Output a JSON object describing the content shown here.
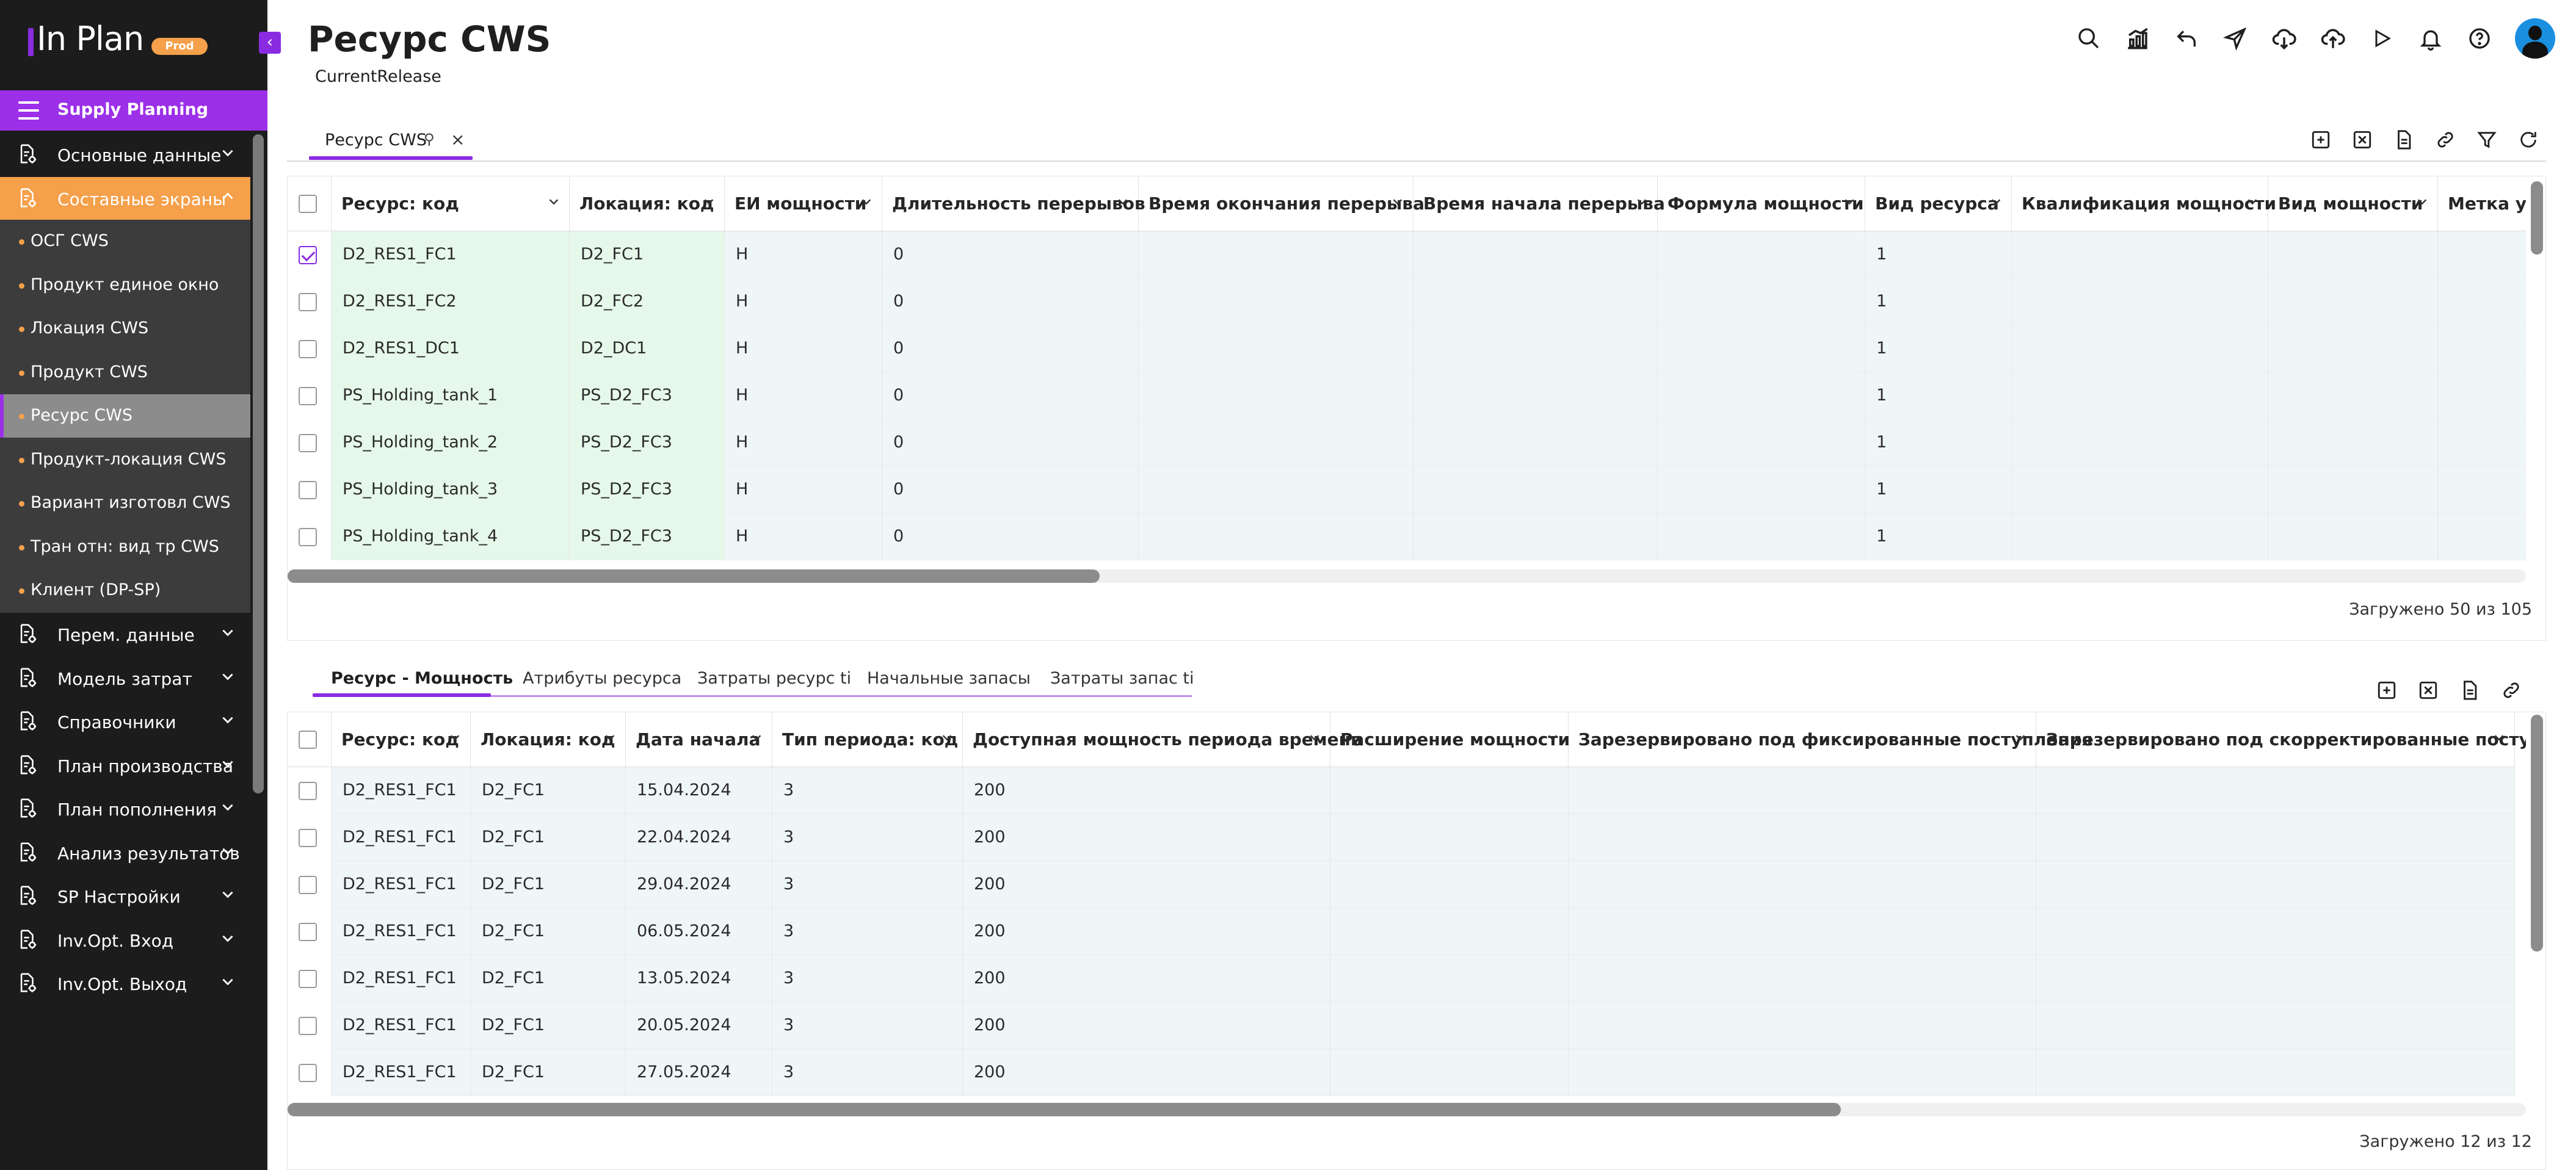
{
  "app": {
    "logo_text": "In Plan",
    "env_badge": "Prod",
    "colors": {
      "accent": "#8a2be2",
      "nav_active": "#f5a04a",
      "sidebar_bg": "#1c1c1c",
      "key_column_bg": "#e6f8e9",
      "row_tint": "#eff6f8"
    }
  },
  "sidebar": {
    "section_title": "Supply Planning",
    "top_items": [
      {
        "label": "Основные данные",
        "icon": "document-gear-icon"
      },
      {
        "label": "Составные экраны",
        "icon": "document-gear-icon"
      }
    ],
    "sub_items": [
      {
        "label": "ОСГ CWS"
      },
      {
        "label": "Продукт единое окно"
      },
      {
        "label": "Локация CWS"
      },
      {
        "label": "Продукт CWS"
      },
      {
        "label": "Ресурс CWS"
      },
      {
        "label": "Продукт-локация CWS"
      },
      {
        "label": "Вариант изготовл CWS"
      },
      {
        "label": "Тран отн: вид тр CWS"
      },
      {
        "label": "Клиент (DP-SP)"
      }
    ],
    "bottom_items": [
      {
        "label": "Перем. данные",
        "icon": "document-gear-icon"
      },
      {
        "label": "Модель затрат",
        "icon": "document-gear-icon"
      },
      {
        "label": "Справочники",
        "icon": "document-gear-icon"
      },
      {
        "label": "План производства",
        "icon": "document-gear-icon"
      },
      {
        "label": "План пополнения",
        "icon": "document-gear-icon"
      },
      {
        "label": "Анализ результатов",
        "icon": "document-gear-icon"
      },
      {
        "label": "SP Настройки",
        "icon": "document-gear-icon"
      },
      {
        "label": "Inv.Opt. Вход",
        "icon": "document-gear-icon"
      },
      {
        "label": "Inv.Opt. Выход",
        "icon": "document-gear-icon"
      }
    ]
  },
  "header": {
    "title": "Ресурс CWS",
    "subtitle": "CurrentRelease",
    "icons": [
      "search-icon",
      "chart-icon",
      "undo-icon",
      "send-icon",
      "cloud-download-icon",
      "cloud-upload-icon",
      "play-icon",
      "bell-icon",
      "help-icon"
    ]
  },
  "tabs": [
    {
      "label": "Ресурс CWS"
    }
  ],
  "grid_main": {
    "columns": [
      {
        "label": "Ресурс: код"
      },
      {
        "label": "Локация: код"
      },
      {
        "label": "ЕИ мощности"
      },
      {
        "label": "Длительность перерывов"
      },
      {
        "label": "Время окончания перерыва"
      },
      {
        "label": "Время начала перерыва"
      },
      {
        "label": "Формула мощности"
      },
      {
        "label": "Вид ресурса"
      },
      {
        "label": "Квалификация мощности"
      },
      {
        "label": "Вид мощности"
      },
      {
        "label": "Метка уда"
      }
    ],
    "rows": [
      {
        "checked": true,
        "cells": [
          "D2_RES1_FC1",
          "D2_FC1",
          "H",
          "0",
          "",
          "",
          "",
          "1",
          "",
          "",
          ""
        ]
      },
      {
        "checked": false,
        "cells": [
          "D2_RES1_FC2",
          "D2_FC2",
          "H",
          "0",
          "",
          "",
          "",
          "1",
          "",
          "",
          ""
        ]
      },
      {
        "checked": false,
        "cells": [
          "D2_RES1_DC1",
          "D2_DC1",
          "H",
          "0",
          "",
          "",
          "",
          "1",
          "",
          "",
          ""
        ]
      },
      {
        "checked": false,
        "cells": [
          "PS_Holding_tank_1",
          "PS_D2_FC3",
          "H",
          "0",
          "",
          "",
          "",
          "1",
          "",
          "",
          ""
        ]
      },
      {
        "checked": false,
        "cells": [
          "PS_Holding_tank_2",
          "PS_D2_FC3",
          "H",
          "0",
          "",
          "",
          "",
          "1",
          "",
          "",
          ""
        ]
      },
      {
        "checked": false,
        "cells": [
          "PS_Holding_tank_3",
          "PS_D2_FC3",
          "H",
          "0",
          "",
          "",
          "",
          "1",
          "",
          "",
          ""
        ]
      },
      {
        "checked": false,
        "cells": [
          "PS_Holding_tank_4",
          "PS_D2_FC3",
          "H",
          "0",
          "",
          "",
          "",
          "1",
          "",
          "",
          ""
        ]
      }
    ],
    "status": "Загружено 50 из 105"
  },
  "detail": {
    "tabs": [
      {
        "label": "Ресурс - Мощность"
      },
      {
        "label": "Атрибуты ресурса"
      },
      {
        "label": "Затраты ресурс ti"
      },
      {
        "label": "Начальные запасы"
      },
      {
        "label": "Затраты запас ti"
      }
    ],
    "columns": [
      {
        "label": "Ресурс: код"
      },
      {
        "label": "Локация: код"
      },
      {
        "label": "Дата начала"
      },
      {
        "label": "Тип периода: код"
      },
      {
        "label": "Доступная мощность периода времени"
      },
      {
        "label": "Расширение мощности"
      },
      {
        "label": "Зарезервировано под фиксированные поступления"
      },
      {
        "label": "Зарезервировано под скорректированные поступления"
      }
    ],
    "rows": [
      {
        "cells": [
          "D2_RES1_FC1",
          "D2_FC1",
          "15.04.2024",
          "3",
          "200",
          "",
          "",
          ""
        ]
      },
      {
        "cells": [
          "D2_RES1_FC1",
          "D2_FC1",
          "22.04.2024",
          "3",
          "200",
          "",
          "",
          ""
        ]
      },
      {
        "cells": [
          "D2_RES1_FC1",
          "D2_FC1",
          "29.04.2024",
          "3",
          "200",
          "",
          "",
          ""
        ]
      },
      {
        "cells": [
          "D2_RES1_FC1",
          "D2_FC1",
          "06.05.2024",
          "3",
          "200",
          "",
          "",
          ""
        ]
      },
      {
        "cells": [
          "D2_RES1_FC1",
          "D2_FC1",
          "13.05.2024",
          "3",
          "200",
          "",
          "",
          ""
        ]
      },
      {
        "cells": [
          "D2_RES1_FC1",
          "D2_FC1",
          "20.05.2024",
          "3",
          "200",
          "",
          "",
          ""
        ]
      },
      {
        "cells": [
          "D2_RES1_FC1",
          "D2_FC1",
          "27.05.2024",
          "3",
          "200",
          "",
          "",
          ""
        ]
      }
    ],
    "status": "Загружено 12 из 12"
  }
}
